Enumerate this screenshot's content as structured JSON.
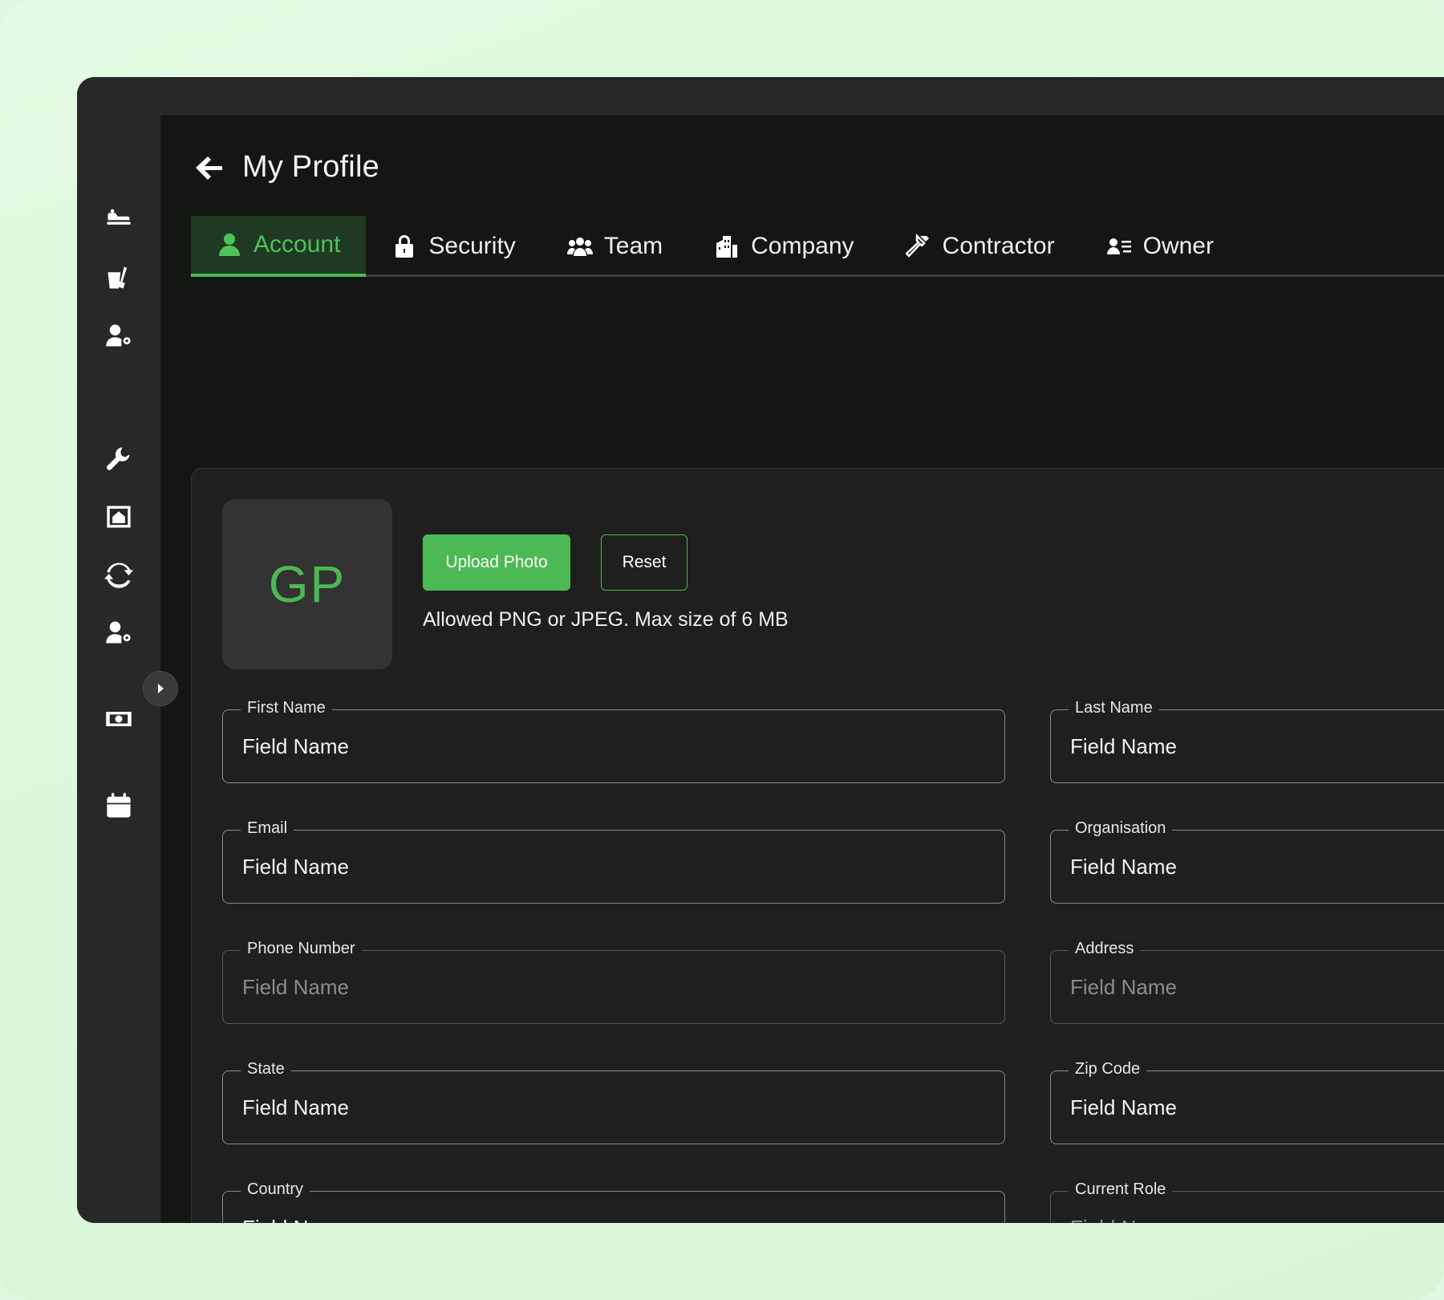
{
  "page": {
    "title": "My Profile"
  },
  "sidebar": {
    "items": [
      {
        "name": "sidebar-item-services",
        "icon": "serving-tray-icon"
      },
      {
        "name": "sidebar-item-cleaning",
        "icon": "cleaning-bucket-icon"
      },
      {
        "name": "sidebar-item-user-settings",
        "icon": "user-gear-icon"
      },
      {
        "name": "sidebar-item-maintenance",
        "icon": "wrench-icon"
      },
      {
        "name": "sidebar-item-property",
        "icon": "house-frame-icon"
      },
      {
        "name": "sidebar-item-sync",
        "icon": "sync-icon"
      },
      {
        "name": "sidebar-item-users",
        "icon": "user-gear-icon"
      },
      {
        "name": "sidebar-item-payments",
        "icon": "money-icon"
      },
      {
        "name": "sidebar-item-calendar",
        "icon": "calendar-icon"
      }
    ]
  },
  "tabs": [
    {
      "label": "Account",
      "icon": "user-icon",
      "active": true
    },
    {
      "label": "Security",
      "icon": "lock-icon",
      "active": false
    },
    {
      "label": "Team",
      "icon": "team-icon",
      "active": false
    },
    {
      "label": "Company",
      "icon": "building-icon",
      "active": false
    },
    {
      "label": "Contractor",
      "icon": "hammer-icon",
      "active": false
    },
    {
      "label": "Owner",
      "icon": "owner-list-icon",
      "active": false
    }
  ],
  "profile": {
    "avatar_initials": "GP",
    "upload_label": "Upload Photo",
    "reset_label": "Reset",
    "upload_hint": "Allowed PNG or JPEG. Max size of 6 MB"
  },
  "form": {
    "first_name": {
      "label": "First Name",
      "placeholder": "Field Name"
    },
    "last_name": {
      "label": "Last Name",
      "placeholder": "Field Name"
    },
    "email": {
      "label": "Email",
      "placeholder": "Field Name"
    },
    "organisation": {
      "label": "Organisation",
      "placeholder": "Field Name"
    },
    "phone": {
      "label": "Phone Number",
      "placeholder": "Field Name"
    },
    "address": {
      "label": "Address",
      "placeholder": "Field Name"
    },
    "state": {
      "label": "State",
      "placeholder": "Field Name"
    },
    "zip": {
      "label": "Zip Code",
      "placeholder": "Field Name"
    },
    "country": {
      "label": "Country",
      "placeholder": "Field Name"
    },
    "current_role": {
      "label": "Current Role",
      "placeholder": "Field Name"
    }
  },
  "colors": {
    "accent": "#4cb954",
    "background": "#141614",
    "sidebar": "#282828",
    "card": "#1f1f1f",
    "backdrop": "#dff8df"
  }
}
